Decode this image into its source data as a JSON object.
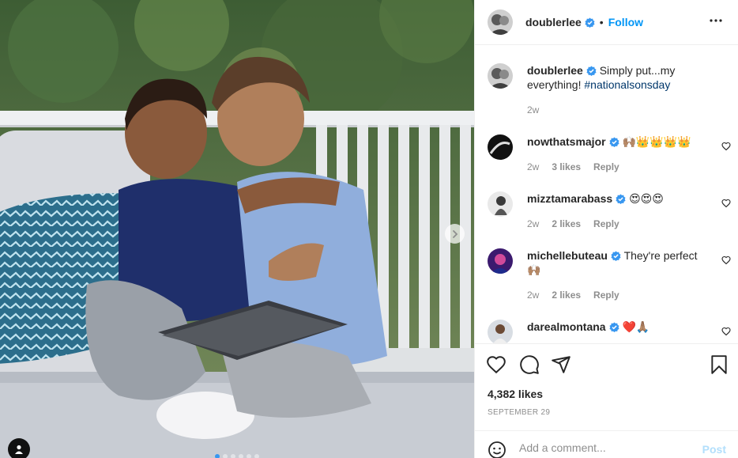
{
  "post": {
    "author": "doublerlee",
    "follow_label": "Follow",
    "separator": "•",
    "caption": {
      "username": "doublerlee",
      "text": "Simply put...my everything! ",
      "hashtag": "#nationalsonsday",
      "time": "2w"
    },
    "comments": [
      {
        "username": "nowthatsmajor",
        "text": "🙌🏽👑👑👑👑",
        "time": "2w",
        "likes": "3 likes",
        "reply": "Reply"
      },
      {
        "username": "mizztamarabass",
        "text": "😍😍😍",
        "time": "2w",
        "likes": "2 likes",
        "reply": "Reply"
      },
      {
        "username": "michellebuteau",
        "text": "They're perfect 🙌🏽",
        "time": "2w",
        "likes": "2 likes",
        "reply": "Reply"
      },
      {
        "username": "darealmontana",
        "text": "❤️🙏🏽",
        "time": "",
        "likes": "",
        "reply": ""
      }
    ],
    "likes": "4,382 likes",
    "date": "SEPTEMBER 29",
    "comment_placeholder": "Add a comment...",
    "post_label": "Post",
    "carousel": {
      "count": 6,
      "active": 0
    }
  },
  "colors": {
    "link": "#0095f6",
    "verified": "#3897f0",
    "muted": "#8e8e8e",
    "hashtag": "#00376b"
  },
  "icons": [
    "verified-badge-icon",
    "more-options-icon",
    "heart-icon",
    "comment-icon",
    "share-icon",
    "bookmark-icon",
    "emoji-icon",
    "next-arrow-icon",
    "tag-user-icon"
  ]
}
